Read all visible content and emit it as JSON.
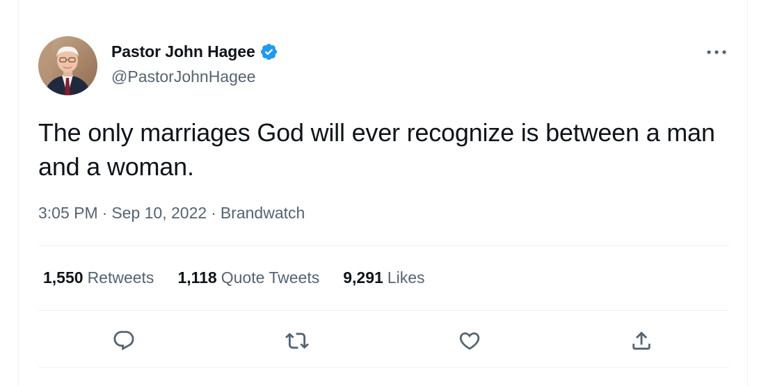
{
  "author": {
    "name": "Pastor John Hagee",
    "handle": "@PastorJohnHagee",
    "verified": true,
    "avatar_icon": "profile-photo"
  },
  "tweet": {
    "text": "The only marriages God will ever recognize is between a man and a woman.",
    "time": "3:05 PM",
    "date": "Sep 10, 2022",
    "separator": "·",
    "source": "Brandwatch"
  },
  "stats": {
    "retweets": {
      "count": "1,550",
      "label": "Retweets"
    },
    "quote_tweets": {
      "count": "1,118",
      "label": "Quote Tweets"
    },
    "likes": {
      "count": "9,291",
      "label": "Likes"
    }
  },
  "actions": {
    "reply_icon": "speech-bubble-icon",
    "retweet_icon": "retweet-arrows-icon",
    "like_icon": "heart-icon",
    "share_icon": "share-upload-icon"
  },
  "colors": {
    "text_primary": "#0f1419",
    "text_secondary": "#536471",
    "verified_blue": "#1d9bf0",
    "divider": "#eff3f4"
  }
}
